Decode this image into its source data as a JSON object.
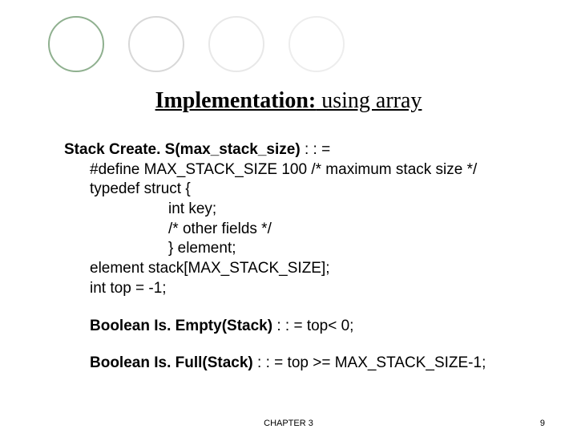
{
  "title": {
    "bold": "Implementation:",
    "rest": " using array"
  },
  "create": {
    "sig": "Stack Create. S(max_stack_size) ",
    "op": ": : =",
    "l1": "#define MAX_STACK_SIZE 100 /* maximum stack size */",
    "l2": "typedef struct {",
    "l3": "int key;",
    "l4": "/* other fields */",
    "l5": "} element;",
    "l6": "element stack[MAX_STACK_SIZE];",
    "l7": "int top = -1;"
  },
  "isempty": {
    "sig": "Boolean Is. Empty(Stack)",
    "rest": " : : = top< 0;"
  },
  "isfull": {
    "sig": "Boolean Is. Full(Stack)",
    "rest": " : : = top >= MAX_STACK_SIZE-1;"
  },
  "footer": {
    "chapter": "CHAPTER 3",
    "page": "9"
  }
}
